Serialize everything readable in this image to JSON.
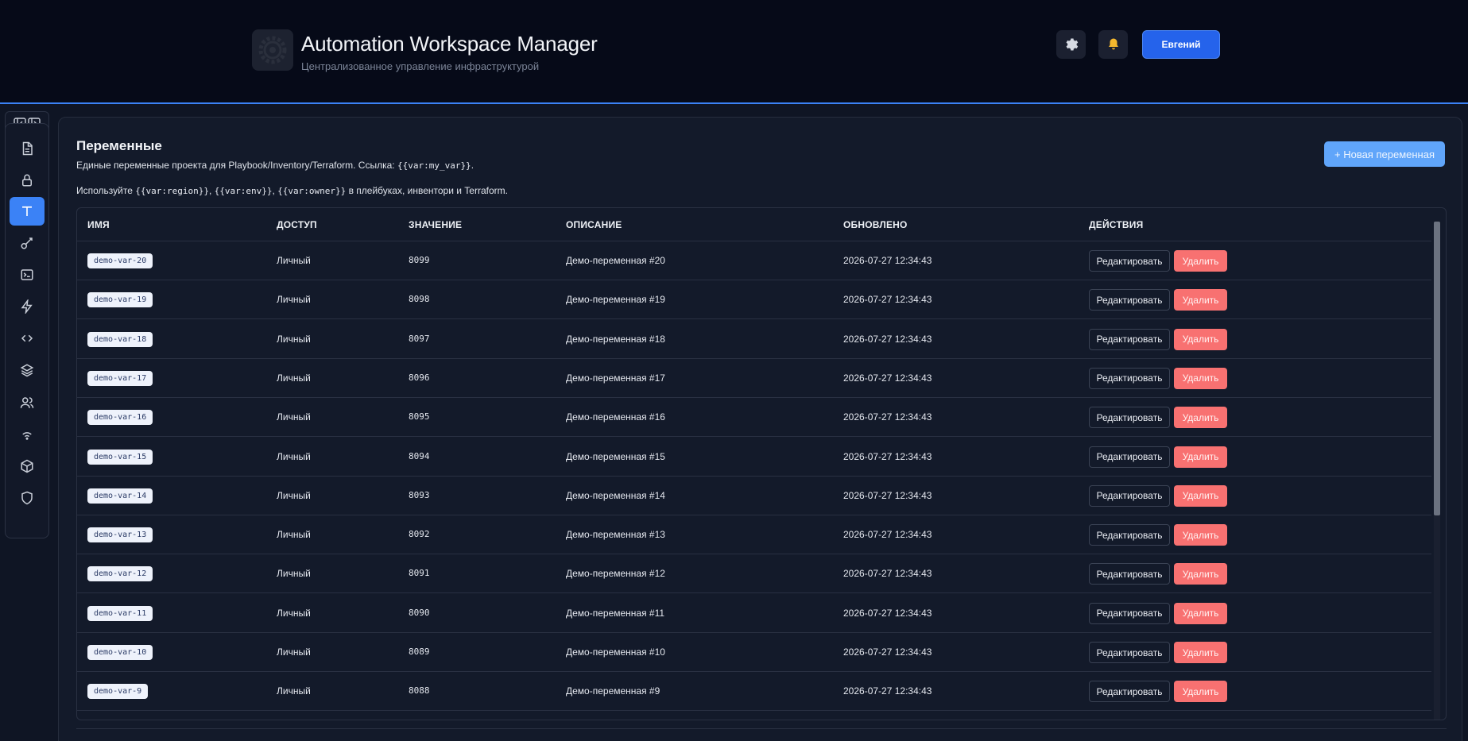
{
  "header": {
    "title": "Automation Workspace Manager",
    "subtitle": "Централизованное управление инфраструктурой",
    "logo_icon": "gear-logo-icon",
    "settings_icon": "gear-icon",
    "notifications_icon": "bell-icon",
    "user_label": "Евгений",
    "accent_color": "#3b82f6"
  },
  "sidebar": {
    "toggle_icon": "sidebar-collapse-icon",
    "items": [
      {
        "icon": "file-icon",
        "active": false
      },
      {
        "icon": "lock-icon",
        "active": false
      },
      {
        "icon": "text-icon",
        "active": true
      },
      {
        "icon": "key-icon",
        "active": false
      },
      {
        "icon": "terminal-icon",
        "active": false
      },
      {
        "icon": "bolt-icon",
        "active": false
      },
      {
        "icon": "code-icon",
        "active": false
      },
      {
        "icon": "layers-icon",
        "active": false
      },
      {
        "icon": "users-icon",
        "active": false
      },
      {
        "icon": "wifi-icon",
        "active": false
      },
      {
        "icon": "cube-icon",
        "active": false
      },
      {
        "icon": "shield-icon",
        "active": false
      }
    ]
  },
  "page": {
    "title": "Переменные",
    "desc_prefix": "Единые переменные проекта для Playbook/Inventory/Terraform. Ссылка: ",
    "desc_code": "{{var:my_var}}",
    "desc_suffix": ".",
    "hint_prefix": "Используйте ",
    "hint_code_1": "{{var:region}}",
    "hint_sep_1": ", ",
    "hint_code_2": "{{var:env}}",
    "hint_sep_2": ", ",
    "hint_code_3": "{{var:owner}}",
    "hint_suffix": " в плейбуках, инвентори и Terraform.",
    "new_button": "+ Новая переменная"
  },
  "table": {
    "columns": [
      "ИМЯ",
      "ДОСТУП",
      "ЗНАЧЕНИЕ",
      "ОПИСАНИЕ",
      "ОБНОВЛЕНО",
      "ДЕЙСТВИЯ"
    ],
    "edit_label": "Редактировать",
    "delete_label": "Удалить",
    "rows": [
      {
        "name": "demo-var-20",
        "access": "Личный",
        "value": "8099",
        "description": "Демо-переменная #20",
        "updated": "2026-07-27 12:34:43"
      },
      {
        "name": "demo-var-19",
        "access": "Личный",
        "value": "8098",
        "description": "Демо-переменная #19",
        "updated": "2026-07-27 12:34:43"
      },
      {
        "name": "demo-var-18",
        "access": "Личный",
        "value": "8097",
        "description": "Демо-переменная #18",
        "updated": "2026-07-27 12:34:43"
      },
      {
        "name": "demo-var-17",
        "access": "Личный",
        "value": "8096",
        "description": "Демо-переменная #17",
        "updated": "2026-07-27 12:34:43"
      },
      {
        "name": "demo-var-16",
        "access": "Личный",
        "value": "8095",
        "description": "Демо-переменная #16",
        "updated": "2026-07-27 12:34:43"
      },
      {
        "name": "demo-var-15",
        "access": "Личный",
        "value": "8094",
        "description": "Демо-переменная #15",
        "updated": "2026-07-27 12:34:43"
      },
      {
        "name": "demo-var-14",
        "access": "Личный",
        "value": "8093",
        "description": "Демо-переменная #14",
        "updated": "2026-07-27 12:34:43"
      },
      {
        "name": "demo-var-13",
        "access": "Личный",
        "value": "8092",
        "description": "Демо-переменная #13",
        "updated": "2026-07-27 12:34:43"
      },
      {
        "name": "demo-var-12",
        "access": "Личный",
        "value": "8091",
        "description": "Демо-переменная #12",
        "updated": "2026-07-27 12:34:43"
      },
      {
        "name": "demo-var-11",
        "access": "Личный",
        "value": "8090",
        "description": "Демо-переменная #11",
        "updated": "2026-07-27 12:34:43"
      },
      {
        "name": "demo-var-10",
        "access": "Личный",
        "value": "8089",
        "description": "Демо-переменная #10",
        "updated": "2026-07-27 12:34:43"
      },
      {
        "name": "demo-var-9",
        "access": "Личный",
        "value": "8088",
        "description": "Демо-переменная #9",
        "updated": "2026-07-27 12:34:43"
      }
    ]
  }
}
